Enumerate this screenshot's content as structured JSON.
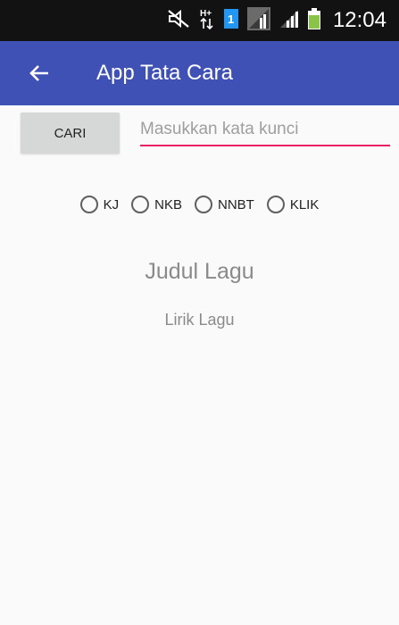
{
  "status_bar": {
    "time": "12:04",
    "icons": [
      "mute-icon",
      "hplus-data-icon",
      "sim-1-icon",
      "signal-icon",
      "signal-2-icon",
      "battery-icon"
    ]
  },
  "app_bar": {
    "title": "App Tata Cara",
    "back_icon": "arrow-left-icon"
  },
  "search": {
    "button_label": "CARI",
    "placeholder": "Masukkan kata kunci",
    "value": ""
  },
  "radio_options": [
    "KJ",
    "NKB",
    "NNBT",
    "KLIK"
  ],
  "content": {
    "title": "Judul Lagu",
    "lyrics": "Lirik Lagu"
  },
  "colors": {
    "app_bar": "#3f51b5",
    "accent": "#e91e63",
    "status_bar": "#121212",
    "battery": "#8bc34a",
    "sim_badge": "#2196f3"
  }
}
